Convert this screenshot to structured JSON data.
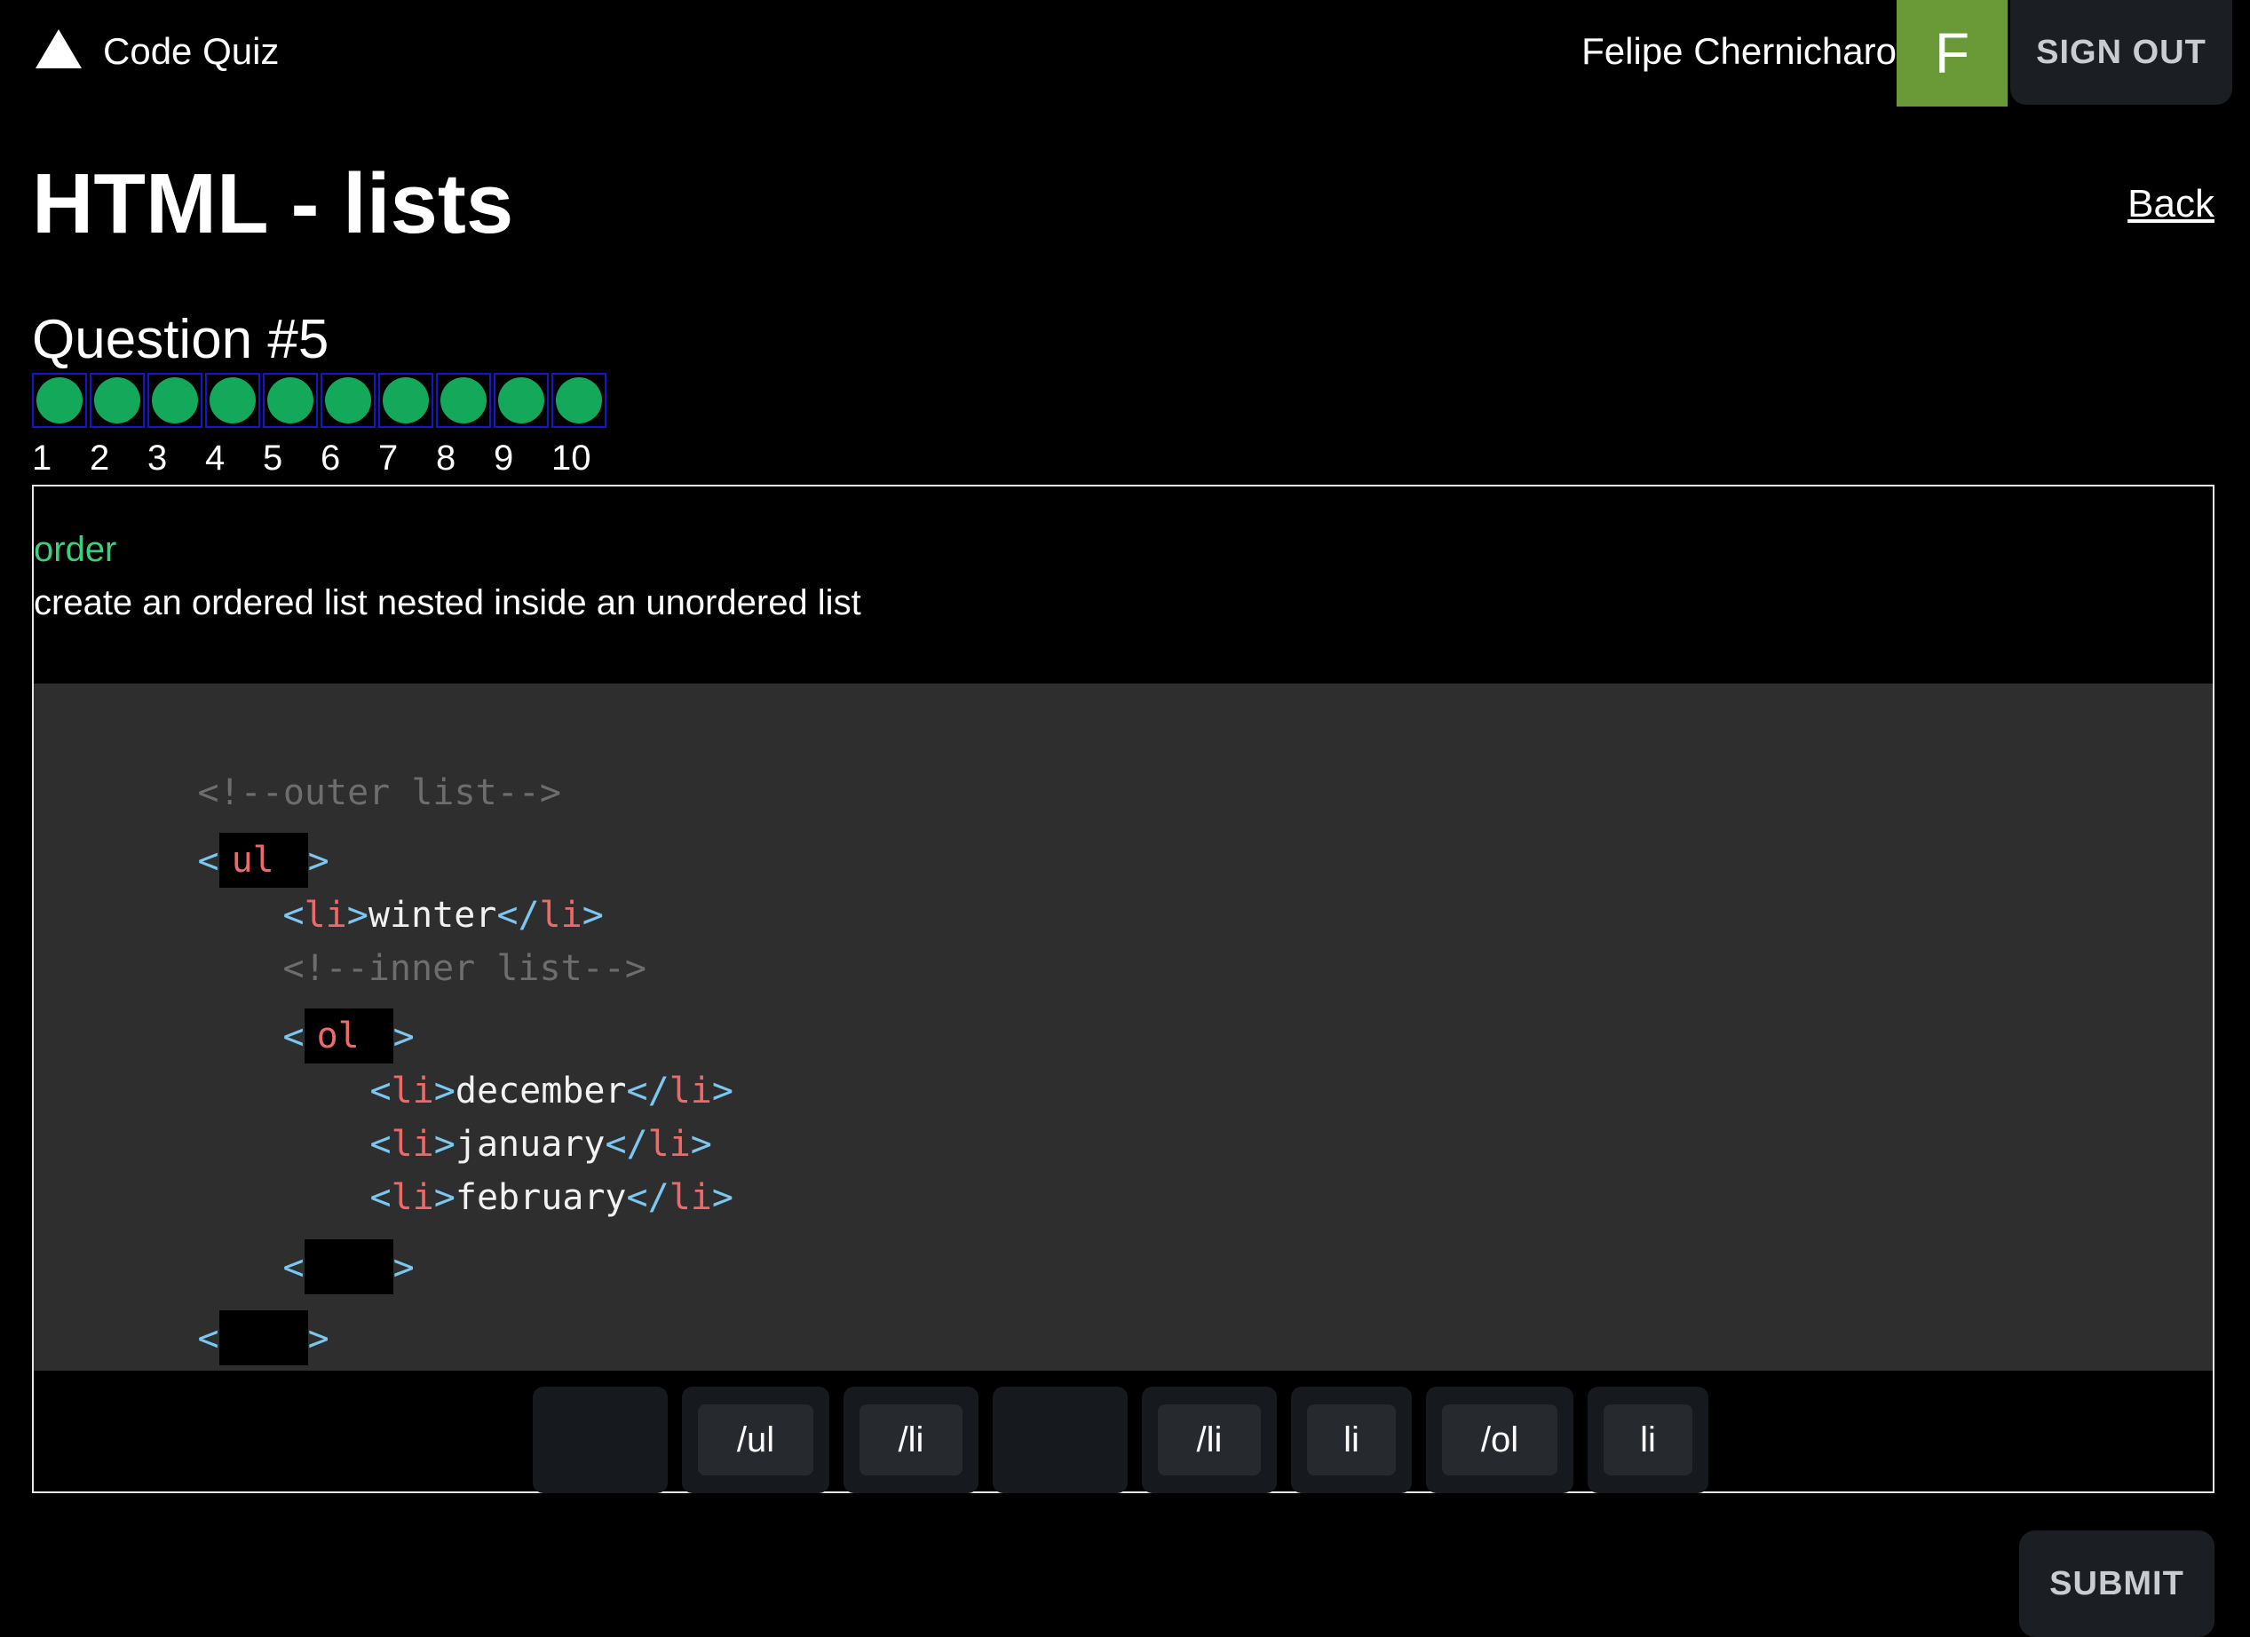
{
  "header": {
    "app_title": "Code Quiz",
    "user_name": "Felipe Chernicharo",
    "avatar_letter": "F",
    "sign_out_label": "SIGN OUT",
    "avatar_color": "#6a9a37"
  },
  "page": {
    "title": "HTML - lists",
    "back_label": "Back"
  },
  "question": {
    "label": "Question #5",
    "progress": [
      {
        "number": "1",
        "status": "answered"
      },
      {
        "number": "2",
        "status": "answered"
      },
      {
        "number": "3",
        "status": "answered"
      },
      {
        "number": "4",
        "status": "answered"
      },
      {
        "number": "5",
        "status": "answered"
      },
      {
        "number": "6",
        "status": "answered"
      },
      {
        "number": "7",
        "status": "answered"
      },
      {
        "number": "8",
        "status": "answered"
      },
      {
        "number": "9",
        "status": "answered"
      },
      {
        "number": "10",
        "status": "answered"
      }
    ],
    "progress_color": "#14a85a",
    "type": "order",
    "description": "create an ordered list nested inside an unordered list"
  },
  "code": {
    "comment_outer": "<!--outer list-->",
    "slot_outer_open": "ul",
    "li_winter": "winter",
    "comment_inner": "<!--inner list-->",
    "slot_inner_open": "ol",
    "li_december": "december",
    "li_january": "january",
    "li_february": "february",
    "slot_inner_close": "",
    "slot_outer_close": "",
    "open_bracket": "<",
    "close_bracket": ">",
    "li_open": "<li>",
    "li_close": "</li>",
    "li_tag": "li"
  },
  "tiles": [
    {
      "label": "",
      "used": true
    },
    {
      "label": "/ul",
      "used": false
    },
    {
      "label": "/li",
      "used": false
    },
    {
      "label": "",
      "used": true
    },
    {
      "label": "/li",
      "used": false
    },
    {
      "label": "li",
      "used": false
    },
    {
      "label": "/ol",
      "used": false
    },
    {
      "label": "li",
      "used": false
    }
  ],
  "submit_label": "SUBMIT"
}
